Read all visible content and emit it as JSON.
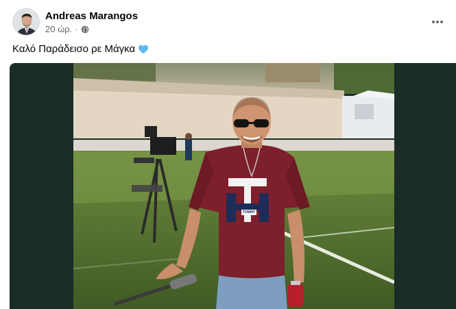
{
  "post": {
    "author": "Andreas Marangos",
    "time": "20 ώρ.",
    "separator": "·",
    "audience_icon": "globe-icon",
    "more_icon": "more-options-icon",
    "caption": "Καλό Παράδεισο ρε Μάγκα",
    "caption_emoji": "light-blue-heart-icon"
  },
  "photo": {
    "shirt_text": "TOMMY",
    "subject": "man in maroon t-shirt and sunglasses on a football pitch"
  },
  "colors": {
    "text_primary": "#050505",
    "text_secondary": "#65676b",
    "media_background": "#1b2b26",
    "heart": "#5eb8f2"
  }
}
